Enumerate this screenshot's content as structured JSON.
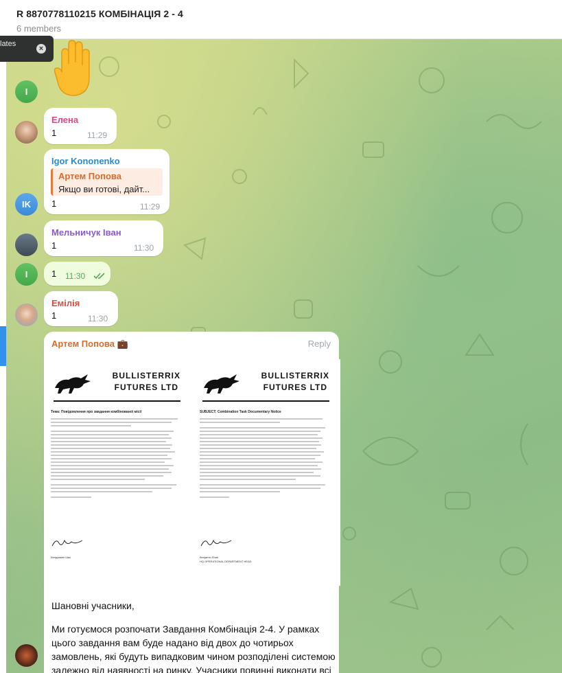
{
  "header": {
    "title": "R 8870778110215 КОМБІНАЦІЯ 2 - 4",
    "subtitle": "6 members"
  },
  "toast": {
    "text": "lates"
  },
  "messages": [
    {
      "sender": "Елена",
      "text": "1",
      "time": "11:29",
      "sender_color": "#d44a82"
    },
    {
      "sender": "Igor Kononenko",
      "text": "1",
      "time": "11:29",
      "sender_color": "#2a8bc7",
      "reply": {
        "name": "Артем Попова",
        "text": "Якщо ви готові, дайт..."
      }
    },
    {
      "sender": "Мельничук Іван",
      "text": "1",
      "time": "11:30",
      "sender_color": "#8a5ac8"
    },
    {
      "text": "1",
      "time": "11:30"
    },
    {
      "sender": "Емілія",
      "text": "1",
      "time": "11:30",
      "sender_color": "#d94a3a"
    }
  ],
  "post": {
    "sender": "Артем Попова 💼",
    "reply_label": "Reply",
    "doc_left": {
      "brand_line1": "BULLISTERRIX",
      "brand_line2": "FUTURES LTD",
      "subject": "Тема: Повідомлення про завдання комбінованої місії",
      "signer": "Бенджамін Шах"
    },
    "doc_right": {
      "brand_line1": "BULLISTERRIX",
      "brand_line2": "FUTURES LTD",
      "subject": "SUBJECT: Combination Task Documentary Notice",
      "signer": "Benjamin Shah",
      "role": "HQ OPERATIONAL DEPARTMENT HEAD"
    },
    "caption_greeting": "Шановні учасники,",
    "caption_body": "Ми готуємося розпочати Завдання Комбінація 2-4. У рамках цього завдання вам буде надано від двох до чотирьох замовлень, які будуть випадковим чином розподілені системою залежно від наявності на ринку. Учасники повинні виконати всі"
  },
  "avatars": {
    "initials_i": "I",
    "initials_ik": "IK"
  }
}
